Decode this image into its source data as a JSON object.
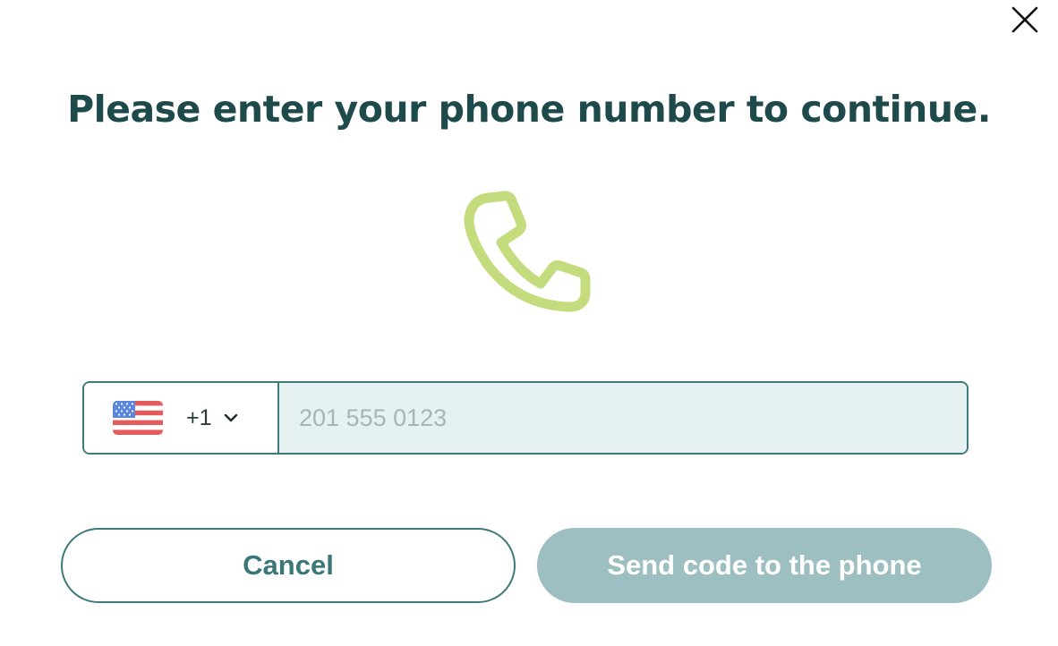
{
  "dialog": {
    "title": "Please enter your phone number to continue.",
    "close_icon": "close-icon",
    "hero_icon": "phone-icon",
    "hero_color": "#c5dc7e"
  },
  "phone": {
    "country_flag": "us-flag-icon",
    "dial_code": "+1",
    "value": "",
    "placeholder": "201 555 0123"
  },
  "actions": {
    "cancel_label": "Cancel",
    "send_label": "Send code to the phone"
  },
  "colors": {
    "title": "#1f4a4b",
    "border": "#3f7a7b",
    "input_bg": "#e6f2f2",
    "send_button_bg": "#9dbfc1"
  }
}
